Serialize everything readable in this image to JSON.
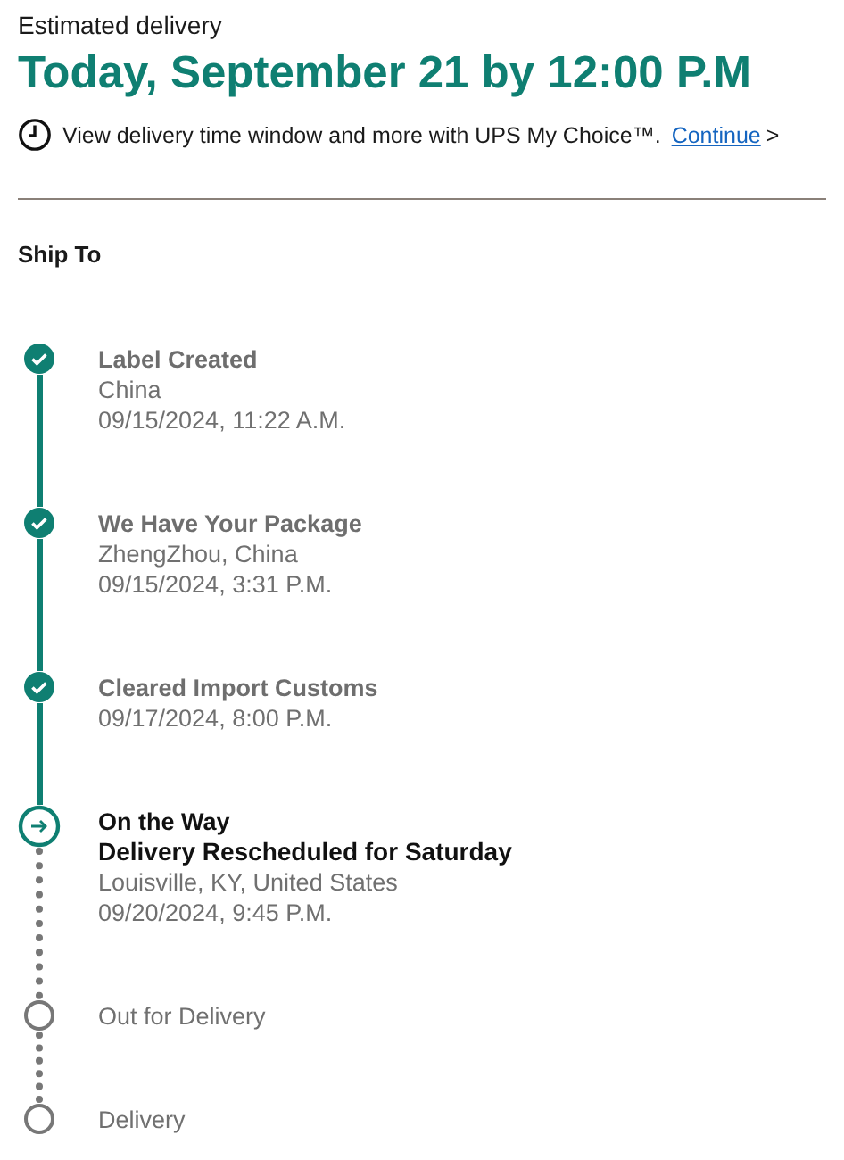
{
  "estimate": {
    "label": "Estimated delivery",
    "date": "Today, September 21 by 12:00 P.M"
  },
  "notice": {
    "text": "View delivery time window and more with UPS My Choice™.",
    "link": "Continue",
    "arrow": ">"
  },
  "ship_to": {
    "label": "Ship To"
  },
  "steps": [
    {
      "kind": "done",
      "title": "Label Created",
      "details": [
        "China",
        "09/15/2024, 11:22 A.M."
      ]
    },
    {
      "kind": "done",
      "title": "We Have Your Package",
      "details": [
        "ZhengZhou, China",
        "09/15/2024, 3:31 P.M."
      ]
    },
    {
      "kind": "done",
      "title": "Cleared Import Customs",
      "details": [
        "09/17/2024, 8:00 P.M."
      ]
    },
    {
      "kind": "current",
      "title": "On the Way",
      "subtitle": "Delivery Rescheduled for Saturday",
      "details": [
        "Louisville, KY, United States",
        "09/20/2024, 9:45 P.M."
      ]
    },
    {
      "kind": "pending",
      "title": "Out for Delivery"
    },
    {
      "kind": "pending",
      "title": "Delivery"
    }
  ]
}
